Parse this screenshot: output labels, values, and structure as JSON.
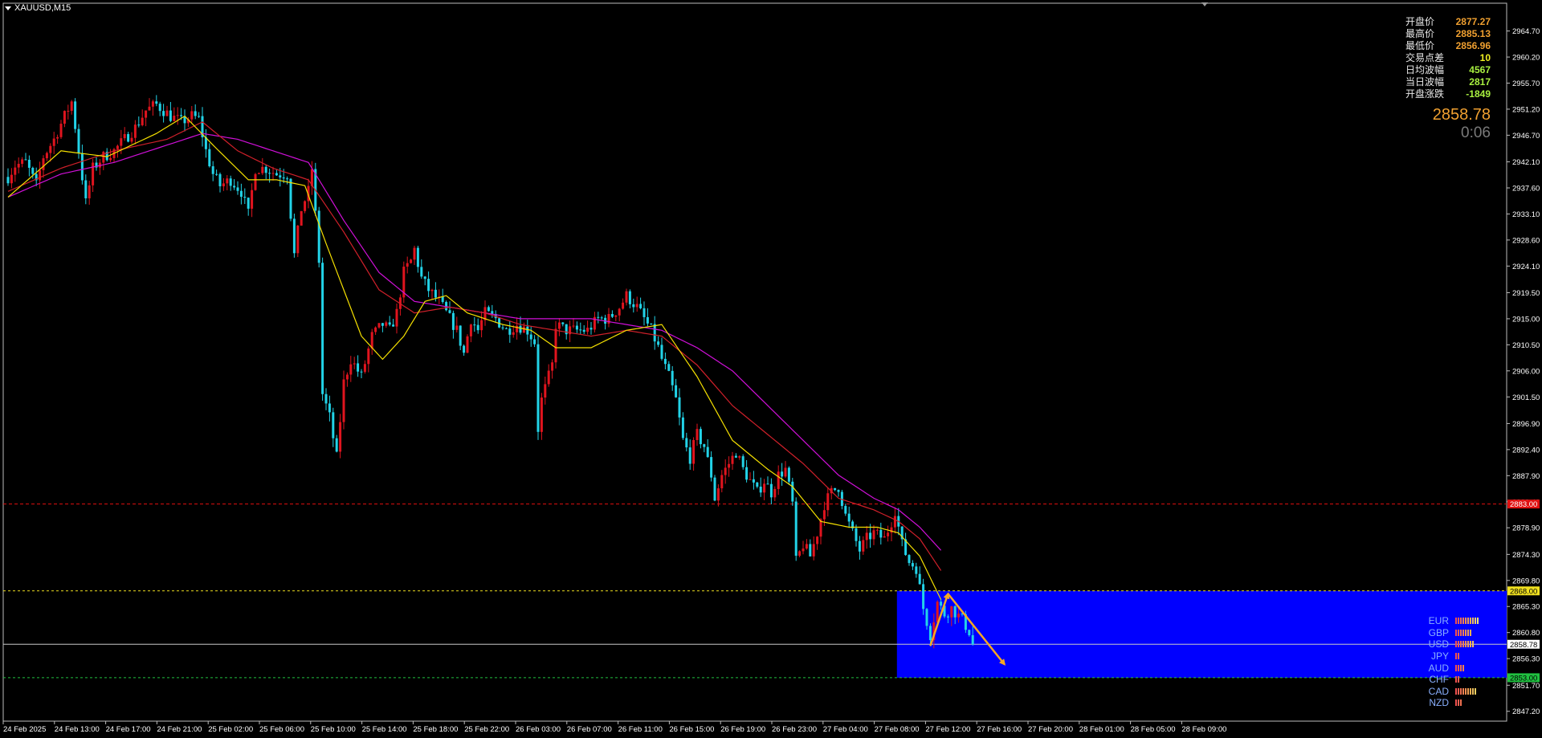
{
  "symbol": "XAUUSD,M15",
  "colors": {
    "background": "#000000",
    "bull": "#e0141e",
    "bear": "#22d3e8",
    "ma_fast": "#f5e000",
    "ma_mid": "#d0202a",
    "ma_slow": "#d010d8",
    "zone": "#0000ff",
    "arrow": "#f5a623",
    "axis": "#ffffff",
    "price_box": "#ffffff",
    "red_level": "#e01010",
    "yellow_level": "#f0e020",
    "green_level": "#20c040"
  },
  "stats": [
    {
      "label": "开盘价",
      "value": "2877.27",
      "color": "#f0a030"
    },
    {
      "label": "最高价",
      "value": "2885.13",
      "color": "#f0a030"
    },
    {
      "label": "最低价",
      "value": "2856.96",
      "color": "#f0a030"
    },
    {
      "label": "交易点差",
      "value": "10",
      "color": "#f0f020"
    },
    {
      "label": "日均波幅",
      "value": "4567",
      "color": "#a8f040"
    },
    {
      "label": "当日波幅",
      "value": "2817",
      "color": "#a8f040"
    },
    {
      "label": "开盘涨跌",
      "value": "-1849",
      "color": "#a8f040"
    }
  ],
  "current_price": "2858.78",
  "timer": "0:06",
  "currencies": [
    {
      "name": "EUR",
      "bars": [
        "#f05050",
        "#f06050",
        "#f07050",
        "#f08050",
        "#f09050",
        "#f0a050",
        "#f0b050",
        "#f0c060",
        "#f0d060",
        "#f0e070"
      ]
    },
    {
      "name": "GBP",
      "bars": [
        "#f05050",
        "#f06050",
        "#f07050",
        "#f08050",
        "#f09050",
        "#f0a050",
        "#f0b050"
      ]
    },
    {
      "name": "USD",
      "bars": [
        "#f05050",
        "#f06050",
        "#f07050",
        "#f08050",
        "#f09050",
        "#f0a050",
        "#f0b050",
        "#f0c060"
      ]
    },
    {
      "name": "JPY",
      "bars": [
        "#f05050",
        "#f06050"
      ]
    },
    {
      "name": "AUD",
      "bars": [
        "#f05050",
        "#f06050",
        "#f07050",
        "#f08050"
      ]
    },
    {
      "name": "CHF",
      "bars": [
        "#f05050",
        "#f06050"
      ]
    },
    {
      "name": "CAD",
      "bars": [
        "#f05050",
        "#f06050",
        "#f07050",
        "#f08050",
        "#f09050",
        "#f0a050",
        "#f0b050",
        "#f0c060",
        "#f0d060"
      ]
    },
    {
      "name": "NZD",
      "bars": [
        "#f05050",
        "#f06050",
        "#f07050"
      ]
    }
  ],
  "chart_data": {
    "type": "candlestick",
    "symbol": "XAUUSD",
    "timeframe": "M15",
    "ylim": [
      2845.5,
      2969.5
    ],
    "y_ticks": [
      "2964.70",
      "2960.20",
      "2955.70",
      "2951.20",
      "2946.70",
      "2942.10",
      "2937.60",
      "2933.10",
      "2928.60",
      "2924.10",
      "2919.50",
      "2915.00",
      "2910.50",
      "2906.00",
      "2901.50",
      "2896.90",
      "2892.40",
      "2887.90",
      "2883.40",
      "2878.90",
      "2874.30",
      "2869.80",
      "2865.30",
      "2860.80",
      "2856.30",
      "2851.70",
      "2847.20"
    ],
    "x_labels": [
      "24 Feb 2025",
      "24 Feb 13:00",
      "24 Feb 17:00",
      "24 Feb 21:00",
      "25 Feb 02:00",
      "25 Feb 06:00",
      "25 Feb 10:00",
      "25 Feb 14:00",
      "25 Feb 18:00",
      "25 Feb 22:00",
      "26 Feb 03:00",
      "26 Feb 07:00",
      "26 Feb 11:00",
      "26 Feb 15:00",
      "26 Feb 19:00",
      "26 Feb 23:00",
      "27 Feb 04:00",
      "27 Feb 08:00",
      "27 Feb 12:00",
      "27 Feb 16:00",
      "27 Feb 20:00",
      "28 Feb 01:00",
      "28 Feb 05:00",
      "28 Feb 09:00"
    ],
    "levels": [
      {
        "price": 2883.0,
        "label": "2883.00",
        "style": "red"
      },
      {
        "price": 2868.0,
        "label": "2868.00",
        "style": "yellow"
      },
      {
        "price": 2858.78,
        "label": "2858.78",
        "style": "current"
      },
      {
        "price": 2853.0,
        "label": "2853.00",
        "style": "green"
      }
    ],
    "zone": {
      "price_top": 2868.0,
      "price_bottom": 2853.0,
      "start_index": 252
    },
    "arrows": [
      {
        "from": [
          261,
          2858.5
        ],
        "to": [
          266,
          2867.5
        ]
      },
      {
        "from": [
          266,
          2867.5
        ],
        "to": [
          282,
          2855.3
        ]
      }
    ],
    "path_anchors": [
      [
        0,
        2939.5
      ],
      [
        2,
        2941.5
      ],
      [
        5,
        2942
      ],
      [
        8,
        2938
      ],
      [
        10,
        2943
      ],
      [
        13,
        2946
      ],
      [
        16,
        2950
      ],
      [
        18,
        2952.5
      ],
      [
        20,
        2944
      ],
      [
        22,
        2935
      ],
      [
        24,
        2941
      ],
      [
        27,
        2943
      ],
      [
        30,
        2944
      ],
      [
        33,
        2946
      ],
      [
        36,
        2948
      ],
      [
        39,
        2951
      ],
      [
        42,
        2952
      ],
      [
        44,
        2951
      ],
      [
        46,
        2950
      ],
      [
        49,
        2949
      ],
      [
        52,
        2950
      ],
      [
        54,
        2949.5
      ],
      [
        56,
        2944
      ],
      [
        58,
        2940
      ],
      [
        60,
        2938
      ],
      [
        63,
        2939
      ],
      [
        66,
        2937
      ],
      [
        68,
        2933
      ],
      [
        70,
        2941
      ],
      [
        73,
        2941
      ],
      [
        76,
        2940
      ],
      [
        79,
        2940
      ],
      [
        81,
        2926
      ],
      [
        83,
        2934
      ],
      [
        85,
        2937
      ],
      [
        86,
        2941
      ],
      [
        88,
        2925
      ],
      [
        89,
        2902
      ],
      [
        91,
        2898
      ],
      [
        93,
        2891
      ],
      [
        95,
        2904
      ],
      [
        97,
        2908
      ],
      [
        100,
        2905
      ],
      [
        103,
        2912
      ],
      [
        106,
        2914
      ],
      [
        108,
        2913
      ],
      [
        110,
        2916
      ],
      [
        112,
        2923
      ],
      [
        114,
        2925
      ],
      [
        115,
        2927
      ],
      [
        117,
        2922
      ],
      [
        119,
        2920
      ],
      [
        122,
        2918
      ],
      [
        125,
        2915
      ],
      [
        127,
        2913
      ],
      [
        129,
        2909
      ],
      [
        131,
        2915
      ],
      [
        133,
        2913
      ],
      [
        135,
        2916
      ],
      [
        138,
        2915
      ],
      [
        141,
        2913
      ],
      [
        144,
        2914
      ],
      [
        147,
        2913
      ],
      [
        149,
        2911
      ],
      [
        150,
        2896
      ],
      [
        151,
        2901
      ],
      [
        152,
        2903
      ],
      [
        154,
        2907
      ],
      [
        155,
        2914
      ],
      [
        158,
        2913
      ],
      [
        161,
        2913
      ],
      [
        164,
        2913
      ],
      [
        167,
        2915
      ],
      [
        170,
        2915
      ],
      [
        173,
        2917
      ],
      [
        175,
        2919
      ],
      [
        178,
        2917
      ],
      [
        180,
        2915
      ],
      [
        182,
        2913
      ],
      [
        184,
        2910
      ],
      [
        185,
        2908
      ],
      [
        187,
        2905
      ],
      [
        189,
        2901
      ],
      [
        191,
        2894
      ],
      [
        193,
        2891
      ],
      [
        195,
        2895
      ],
      [
        197,
        2893
      ],
      [
        199,
        2888
      ],
      [
        200,
        2884
      ],
      [
        202,
        2888
      ],
      [
        204,
        2890
      ],
      [
        206,
        2892
      ],
      [
        208,
        2889
      ],
      [
        210,
        2887
      ],
      [
        212,
        2885
      ],
      [
        214,
        2887
      ],
      [
        216,
        2885
      ],
      [
        218,
        2888
      ],
      [
        220,
        2889
      ],
      [
        222,
        2883
      ],
      [
        223,
        2873
      ],
      [
        225,
        2876
      ],
      [
        227,
        2874
      ],
      [
        229,
        2878
      ],
      [
        231,
        2883
      ],
      [
        233,
        2885
      ],
      [
        235,
        2886
      ],
      [
        237,
        2881
      ],
      [
        239,
        2878
      ],
      [
        241,
        2875
      ],
      [
        243,
        2877
      ],
      [
        245,
        2878
      ],
      [
        248,
        2877
      ],
      [
        250,
        2880
      ],
      [
        251,
        2882
      ],
      [
        253,
        2876
      ],
      [
        255,
        2873
      ],
      [
        257,
        2872
      ],
      [
        259,
        2865
      ],
      [
        261,
        2860.5
      ],
      [
        263,
        2866
      ],
      [
        265,
        2864
      ],
      [
        267,
        2865
      ],
      [
        270,
        2863
      ],
      [
        272,
        2861
      ],
      [
        273,
        2858.8
      ]
    ],
    "ma_fast_anchors": [
      [
        0,
        2936
      ],
      [
        15,
        2944
      ],
      [
        28,
        2943
      ],
      [
        42,
        2947
      ],
      [
        50,
        2950
      ],
      [
        58,
        2945
      ],
      [
        68,
        2939
      ],
      [
        76,
        2939
      ],
      [
        84,
        2938
      ],
      [
        90,
        2928
      ],
      [
        100,
        2912
      ],
      [
        106,
        2908
      ],
      [
        112,
        2912
      ],
      [
        118,
        2918
      ],
      [
        124,
        2919
      ],
      [
        130,
        2916
      ],
      [
        140,
        2914
      ],
      [
        148,
        2913
      ],
      [
        155,
        2910
      ],
      [
        165,
        2910
      ],
      [
        175,
        2913
      ],
      [
        185,
        2914
      ],
      [
        195,
        2905
      ],
      [
        205,
        2894
      ],
      [
        215,
        2889
      ],
      [
        222,
        2886
      ],
      [
        230,
        2880
      ],
      [
        238,
        2879
      ],
      [
        246,
        2879
      ],
      [
        252,
        2878
      ],
      [
        258,
        2874
      ],
      [
        262,
        2869
      ],
      [
        264,
        2866.5
      ]
    ],
    "ma_mid_anchors": [
      [
        0,
        2937
      ],
      [
        15,
        2941
      ],
      [
        30,
        2944
      ],
      [
        45,
        2946
      ],
      [
        55,
        2949
      ],
      [
        65,
        2944
      ],
      [
        75,
        2941
      ],
      [
        85,
        2939
      ],
      [
        95,
        2930
      ],
      [
        105,
        2920
      ],
      [
        115,
        2916
      ],
      [
        125,
        2917
      ],
      [
        135,
        2916
      ],
      [
        145,
        2914
      ],
      [
        155,
        2913
      ],
      [
        165,
        2912
      ],
      [
        175,
        2913
      ],
      [
        185,
        2912
      ],
      [
        195,
        2907
      ],
      [
        205,
        2900
      ],
      [
        215,
        2895
      ],
      [
        225,
        2890
      ],
      [
        235,
        2884
      ],
      [
        245,
        2882
      ],
      [
        252,
        2880
      ],
      [
        258,
        2877
      ],
      [
        264,
        2871.5
      ]
    ],
    "ma_slow_anchors": [
      [
        0,
        2936
      ],
      [
        15,
        2940
      ],
      [
        30,
        2942
      ],
      [
        45,
        2945
      ],
      [
        55,
        2947
      ],
      [
        65,
        2946
      ],
      [
        75,
        2944
      ],
      [
        85,
        2942
      ],
      [
        95,
        2932
      ],
      [
        105,
        2923
      ],
      [
        115,
        2918
      ],
      [
        125,
        2917
      ],
      [
        135,
        2916
      ],
      [
        145,
        2915
      ],
      [
        155,
        2915
      ],
      [
        165,
        2915
      ],
      [
        175,
        2914
      ],
      [
        185,
        2913
      ],
      [
        195,
        2910
      ],
      [
        205,
        2906
      ],
      [
        215,
        2900
      ],
      [
        225,
        2894
      ],
      [
        235,
        2888
      ],
      [
        245,
        2884
      ],
      [
        252,
        2882
      ],
      [
        258,
        2879
      ],
      [
        264,
        2875
      ]
    ]
  }
}
